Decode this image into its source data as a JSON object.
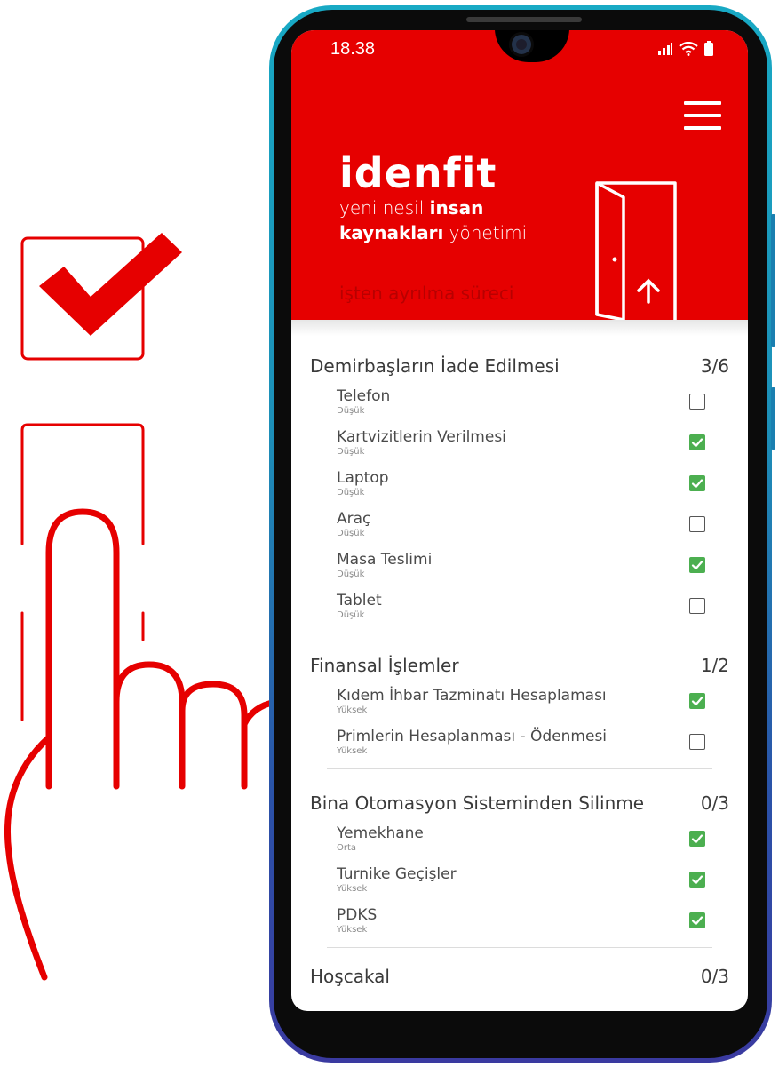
{
  "status_bar": {
    "time": "18.38"
  },
  "header": {
    "brand": "idenfit",
    "tagline_line1_plain": "yeni nesil ",
    "tagline_line1_bold": "insan",
    "tagline_line2_bold": "kaynakları",
    "tagline_line2_plain": " yönetimi",
    "process": "işten ayrılma süreci"
  },
  "colors": {
    "brand_red": "#e60000",
    "check_green": "#4caf50",
    "frame_teal": "#18a9c4"
  },
  "sections": [
    {
      "title": "Demirbaşların İade Edilmesi",
      "count": "3/6",
      "items": [
        {
          "label": "Telefon",
          "priority": "Düşük",
          "checked": false
        },
        {
          "label": "Kartvizitlerin Verilmesi",
          "priority": "Düşük",
          "checked": true
        },
        {
          "label": "Laptop",
          "priority": "Düşük",
          "checked": true
        },
        {
          "label": "Araç",
          "priority": "Düşük",
          "checked": false
        },
        {
          "label": "Masa Teslimi",
          "priority": "Düşük",
          "checked": true
        },
        {
          "label": "Tablet",
          "priority": "Düşük",
          "checked": false
        }
      ]
    },
    {
      "title": "Finansal İşlemler",
      "count": "1/2",
      "items": [
        {
          "label": "Kıdem İhbar Tazminatı Hesaplaması",
          "priority": "Yüksek",
          "checked": true
        },
        {
          "label": "Primlerin Hesaplanması - Ödenmesi",
          "priority": "Yüksek",
          "checked": false
        }
      ]
    },
    {
      "title": "Bina Otomasyon Sisteminden Silinme",
      "count": "0/3",
      "items": [
        {
          "label": "Yemekhane",
          "priority": "Orta",
          "checked": true
        },
        {
          "label": "Turnike Geçişler",
          "priority": "Yüksek",
          "checked": true
        },
        {
          "label": "PDKS",
          "priority": "Yüksek",
          "checked": true
        }
      ]
    },
    {
      "title": "Hoşcakal",
      "count": "0/3",
      "items": []
    }
  ]
}
